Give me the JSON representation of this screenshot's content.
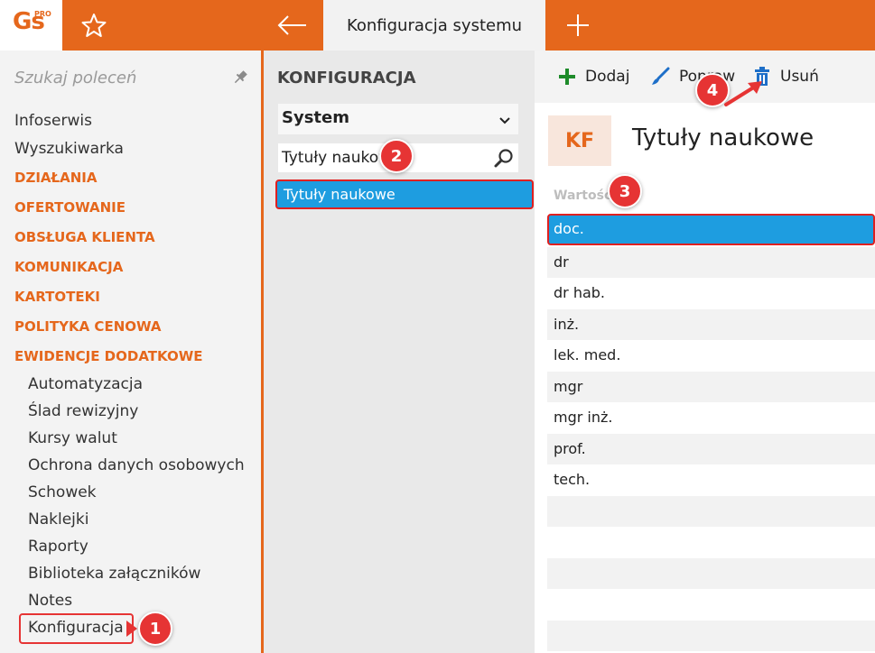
{
  "app": {
    "logo_text": "Gs",
    "logo_superscript": "PRO",
    "active_tab_label": "Konfiguracja systemu"
  },
  "sidebar": {
    "search_placeholder": "Szukaj poleceń",
    "items": [
      {
        "label": "Infoserwis",
        "kind": "item"
      },
      {
        "label": "Wyszukiwarka",
        "kind": "item"
      },
      {
        "label": "DZIAŁANIA",
        "kind": "category"
      },
      {
        "label": "OFERTOWANIE",
        "kind": "category"
      },
      {
        "label": "OBSŁUGA KLIENTA",
        "kind": "category"
      },
      {
        "label": "KOMUNIKACJA",
        "kind": "category"
      },
      {
        "label": "KARTOTEKI",
        "kind": "category"
      },
      {
        "label": "POLITYKA CENOWA",
        "kind": "category"
      },
      {
        "label": "EWIDENCJE DODATKOWE",
        "kind": "category"
      },
      {
        "label": "Automatyzacja",
        "kind": "sub"
      },
      {
        "label": "Ślad rewizyjny",
        "kind": "sub"
      },
      {
        "label": "Kursy walut",
        "kind": "sub"
      },
      {
        "label": "Ochrona danych osobowych",
        "kind": "sub"
      },
      {
        "label": "Schowek",
        "kind": "sub"
      },
      {
        "label": "Naklejki",
        "kind": "sub"
      },
      {
        "label": "Raporty",
        "kind": "sub"
      },
      {
        "label": "Biblioteka załączników",
        "kind": "sub"
      },
      {
        "label": "Notes",
        "kind": "sub"
      },
      {
        "label": "Konfiguracja",
        "kind": "sub"
      }
    ]
  },
  "middle": {
    "title": "KONFIGURACJA",
    "select_value": "System",
    "search_value": "Tytuły naukowe",
    "list_items": [
      "Tytuły naukowe"
    ]
  },
  "toolbar": {
    "add_label": "Dodaj",
    "edit_label": "Popraw",
    "delete_label": "Usuń"
  },
  "detail": {
    "badge": "KF",
    "title": "Tytuły naukowe",
    "column_header": "Wartość",
    "rows": [
      "doc.",
      "dr",
      "dr hab.",
      "inż.",
      "lek. med.",
      "mgr",
      "mgr inż.",
      "prof.",
      "tech."
    ],
    "selected_row": "doc."
  },
  "annotations": [
    "1",
    "2",
    "3",
    "4"
  ],
  "colors": {
    "accent": "#e5671c",
    "selection": "#1e9de0",
    "annotation": "#e63434"
  }
}
